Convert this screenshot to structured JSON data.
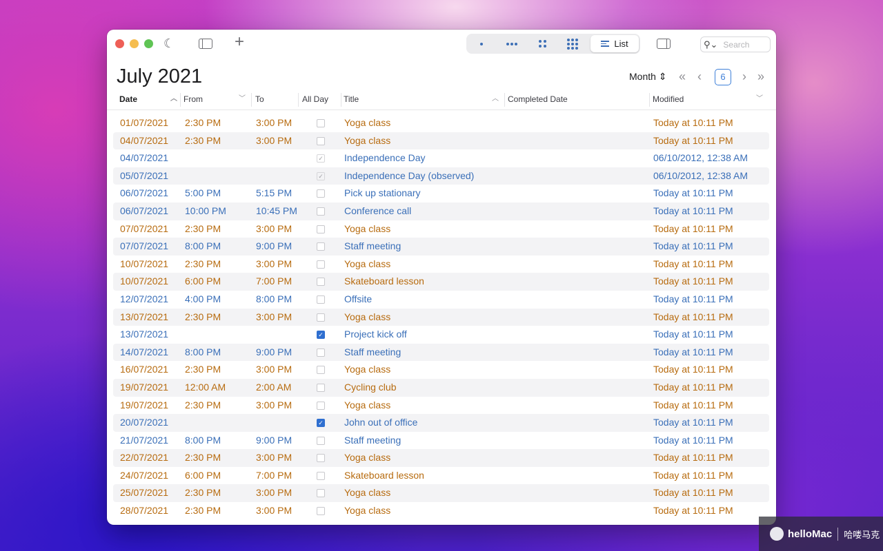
{
  "toolbar": {
    "view_list_label": "List",
    "search_placeholder": "Search"
  },
  "header": {
    "month": "July",
    "year": "2021",
    "scope_label": "Month",
    "today_label": "6"
  },
  "columns": {
    "date": "Date",
    "from": "From",
    "to": "To",
    "all_day": "All Day",
    "title": "Title",
    "completed": "Completed Date",
    "modified": "Modified"
  },
  "colors": {
    "orange": "#b76b0f",
    "blue": "#3a6fb8",
    "accent": "#2f6fd0"
  },
  "rows": [
    {
      "date": "01/07/2021",
      "from": "2:30 PM",
      "to": "3:00 PM",
      "all_day": false,
      "title": "Yoga class",
      "modified": "Today at 10:11 PM",
      "color": "orange"
    },
    {
      "date": "04/07/2021",
      "from": "2:30 PM",
      "to": "3:00 PM",
      "all_day": false,
      "title": "Yoga class",
      "modified": "Today at 10:11 PM",
      "color": "orange"
    },
    {
      "date": "04/07/2021",
      "from": "",
      "to": "",
      "all_day": true,
      "all_day_dim": true,
      "title": "Independence Day",
      "modified": "06/10/2012, 12:38 AM",
      "color": "blue"
    },
    {
      "date": "05/07/2021",
      "from": "",
      "to": "",
      "all_day": true,
      "all_day_dim": true,
      "title": "Independence Day (observed)",
      "modified": "06/10/2012, 12:38 AM",
      "color": "blue"
    },
    {
      "date": "06/07/2021",
      "from": "5:00 PM",
      "to": "5:15 PM",
      "all_day": false,
      "title": "Pick up stationary",
      "modified": "Today at 10:11 PM",
      "color": "blue"
    },
    {
      "date": "06/07/2021",
      "from": "10:00 PM",
      "to": "10:45 PM",
      "all_day": false,
      "title": "Conference call",
      "modified": "Today at 10:11 PM",
      "color": "blue"
    },
    {
      "date": "07/07/2021",
      "from": "2:30 PM",
      "to": "3:00 PM",
      "all_day": false,
      "title": "Yoga class",
      "modified": "Today at 10:11 PM",
      "color": "orange"
    },
    {
      "date": "07/07/2021",
      "from": "8:00 PM",
      "to": "9:00 PM",
      "all_day": false,
      "title": "Staff meeting",
      "modified": "Today at 10:11 PM",
      "color": "blue"
    },
    {
      "date": "10/07/2021",
      "from": "2:30 PM",
      "to": "3:00 PM",
      "all_day": false,
      "title": "Yoga class",
      "modified": "Today at 10:11 PM",
      "color": "orange"
    },
    {
      "date": "10/07/2021",
      "from": "6:00 PM",
      "to": "7:00 PM",
      "all_day": false,
      "title": "Skateboard lesson",
      "modified": "Today at 10:11 PM",
      "color": "orange"
    },
    {
      "date": "12/07/2021",
      "from": "4:00 PM",
      "to": "8:00 PM",
      "all_day": false,
      "title": "Offsite",
      "modified": "Today at 10:11 PM",
      "color": "blue"
    },
    {
      "date": "13/07/2021",
      "from": "2:30 PM",
      "to": "3:00 PM",
      "all_day": false,
      "title": "Yoga class",
      "modified": "Today at 10:11 PM",
      "color": "orange"
    },
    {
      "date": "13/07/2021",
      "from": "",
      "to": "",
      "all_day": true,
      "title": "Project kick off",
      "modified": "Today at 10:11 PM",
      "color": "blue"
    },
    {
      "date": "14/07/2021",
      "from": "8:00 PM",
      "to": "9:00 PM",
      "all_day": false,
      "title": "Staff meeting",
      "modified": "Today at 10:11 PM",
      "color": "blue"
    },
    {
      "date": "16/07/2021",
      "from": "2:30 PM",
      "to": "3:00 PM",
      "all_day": false,
      "title": "Yoga class",
      "modified": "Today at 10:11 PM",
      "color": "orange"
    },
    {
      "date": "19/07/2021",
      "from": "12:00 AM",
      "to": "2:00 AM",
      "all_day": false,
      "title": "Cycling club",
      "modified": "Today at 10:11 PM",
      "color": "orange"
    },
    {
      "date": "19/07/2021",
      "from": "2:30 PM",
      "to": "3:00 PM",
      "all_day": false,
      "title": "Yoga class",
      "modified": "Today at 10:11 PM",
      "color": "orange"
    },
    {
      "date": "20/07/2021",
      "from": "",
      "to": "",
      "all_day": true,
      "title": "John out of office",
      "modified": "Today at 10:11 PM",
      "color": "blue"
    },
    {
      "date": "21/07/2021",
      "from": "8:00 PM",
      "to": "9:00 PM",
      "all_day": false,
      "title": "Staff meeting",
      "modified": "Today at 10:11 PM",
      "color": "blue"
    },
    {
      "date": "22/07/2021",
      "from": "2:30 PM",
      "to": "3:00 PM",
      "all_day": false,
      "title": "Yoga class",
      "modified": "Today at 10:11 PM",
      "color": "orange"
    },
    {
      "date": "24/07/2021",
      "from": "6:00 PM",
      "to": "7:00 PM",
      "all_day": false,
      "title": "Skateboard lesson",
      "modified": "Today at 10:11 PM",
      "color": "orange"
    },
    {
      "date": "25/07/2021",
      "from": "2:30 PM",
      "to": "3:00 PM",
      "all_day": false,
      "title": "Yoga class",
      "modified": "Today at 10:11 PM",
      "color": "orange"
    },
    {
      "date": "28/07/2021",
      "from": "2:30 PM",
      "to": "3:00 PM",
      "all_day": false,
      "title": "Yoga class",
      "modified": "Today at 10:11 PM",
      "color": "orange"
    }
  ],
  "watermark": {
    "brand": "helloMac",
    "cn": "哈喽马克"
  }
}
